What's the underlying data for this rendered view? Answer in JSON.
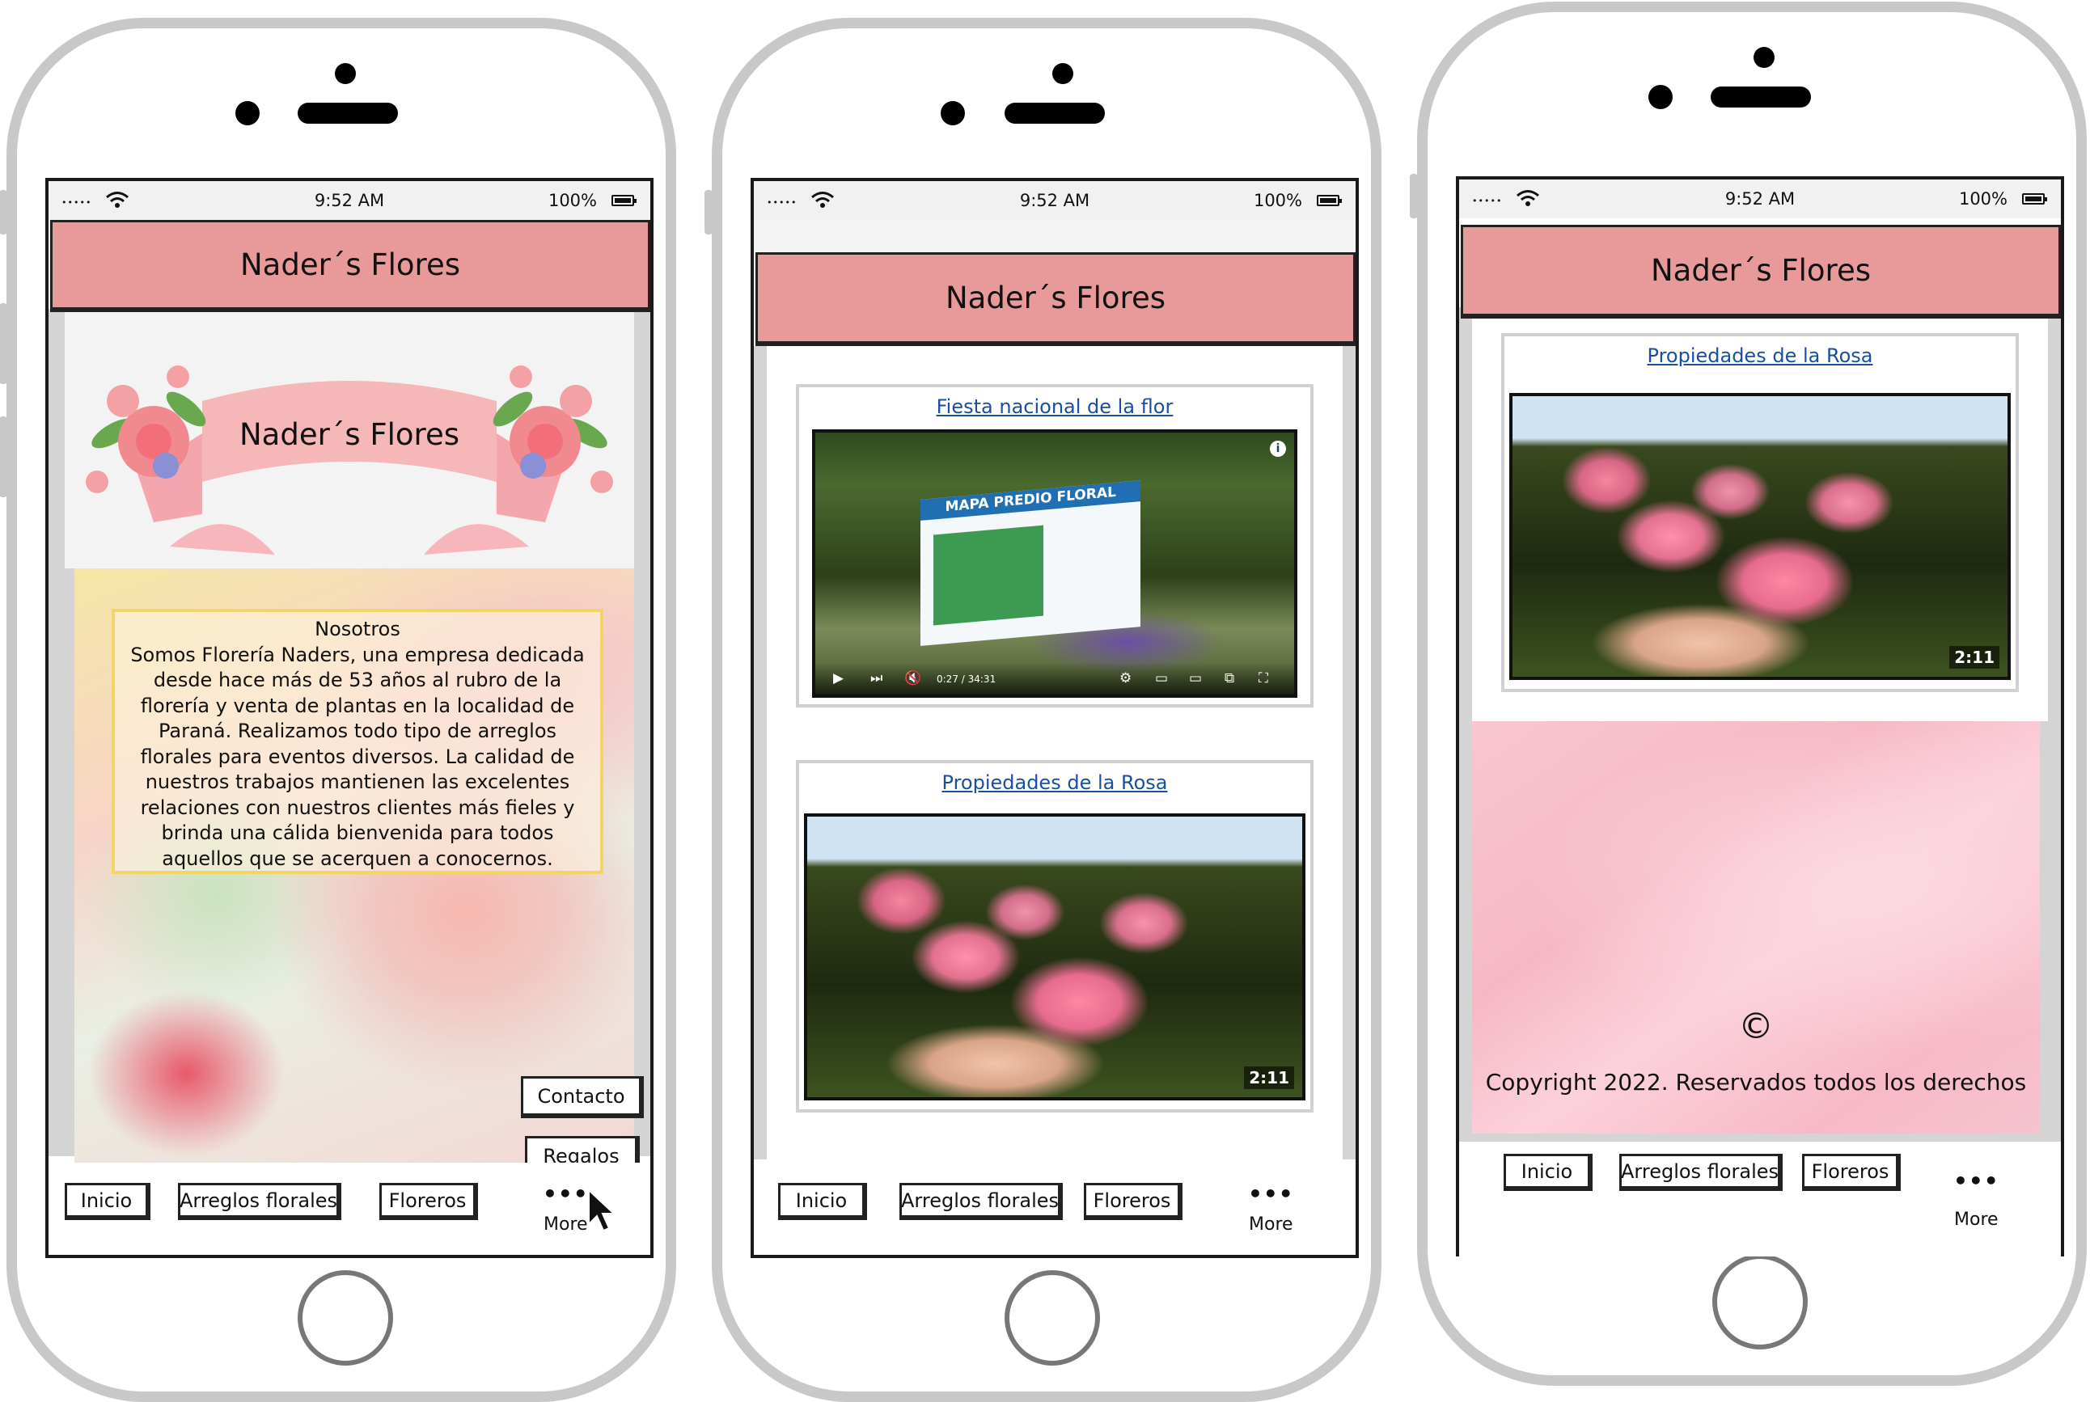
{
  "status_bar": {
    "signal": "•••••",
    "time": "9:52 AM",
    "battery": "100%"
  },
  "app": {
    "title": "Nader´s Flores"
  },
  "banner": {
    "title": "Nader´s Flores"
  },
  "about": {
    "heading": "Nosotros",
    "body": "Somos Florería Naders, una empresa dedicada desde hace más de 53 años al rubro de la florería y venta de plantas en la localidad de Paraná. Realizamos todo tipo de arreglos florales para eventos diversos. La calidad de nuestros trabajos mantienen las excelentes relaciones con nuestros clientes más fieles y brinda una cálida bienvenida para todos aquellos que se acerquen a conocernos."
  },
  "side_buttons": {
    "contact": "Contacto",
    "gifts": "Regalos"
  },
  "tabs": {
    "home": "Inicio",
    "arrangements": "Arreglos florales",
    "vases": "Floreros",
    "more_dots": "•••",
    "more": "More"
  },
  "videos": {
    "festival": {
      "title": "Fiesta nacional de la flor",
      "sign": "MAPA PREDIO FLORAL",
      "time": "0:27 / 34:31",
      "info": "i"
    },
    "rose": {
      "title": "Propiedades de la Rosa",
      "duration": "2:11"
    }
  },
  "footer": {
    "symbol": "©",
    "text": "Copyright 2022. Reservados todos los derechos"
  },
  "colors": {
    "appbar": "#e89a9a",
    "link": "#1a4fa0",
    "about_border": "#f3d46b",
    "footer_pink": "#f7b8c6"
  }
}
